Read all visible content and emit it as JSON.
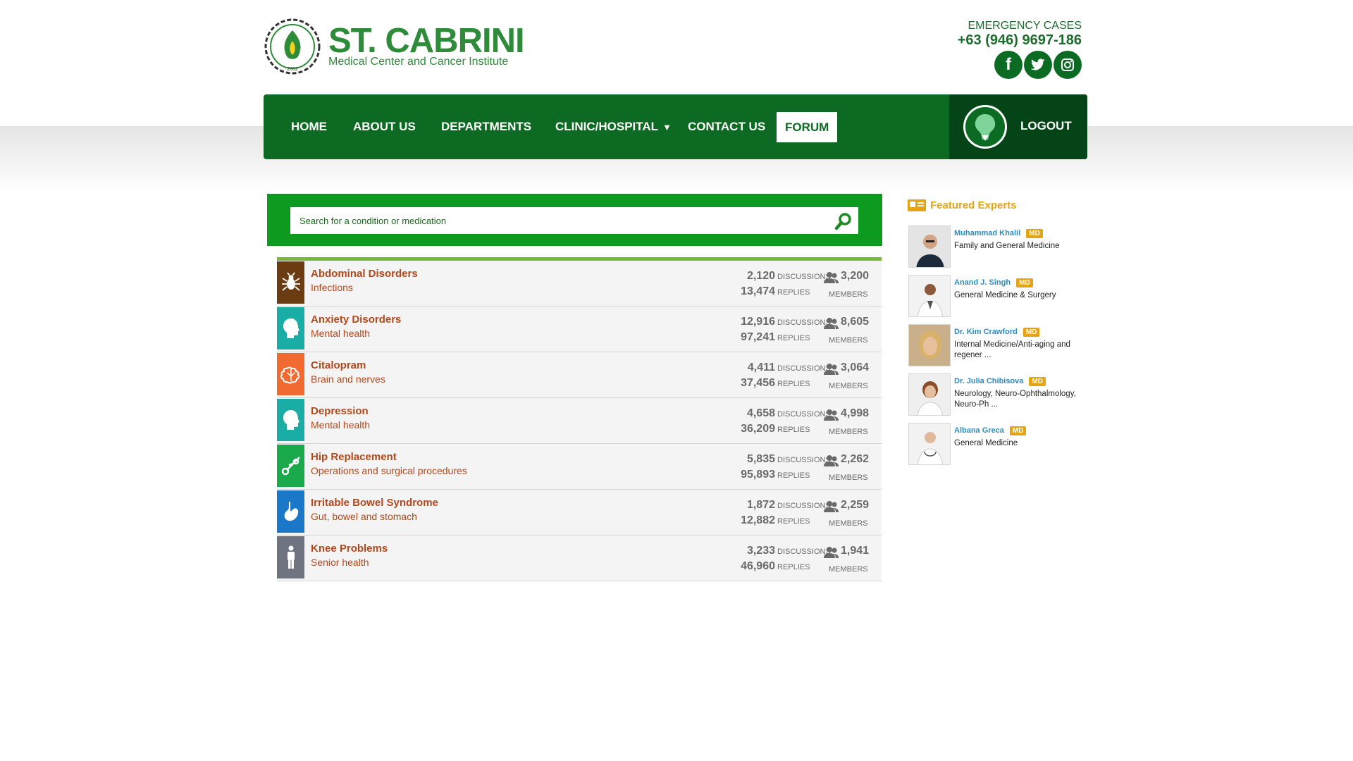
{
  "brand": {
    "name": "ST. CABRINI",
    "subtitle": "Medical Center and Cancer Institute",
    "logo_year": "2002"
  },
  "contact": {
    "emergency_label": "EMERGENCY CASES",
    "phone": "+63 (946) 9697-186",
    "social": [
      "facebook-icon",
      "twitter-icon",
      "instagram-icon"
    ]
  },
  "nav": {
    "home": "HOME",
    "about": "ABOUT US",
    "departments": "DEPARTMENTS",
    "clinic": "CLINIC/HOSPITAL",
    "contact": "CONTACT US",
    "forum": "FORUM",
    "logout": "LOGOUT"
  },
  "search": {
    "placeholder": "Search for a condition or medication"
  },
  "labels": {
    "discussions": "DISCUSSIONS",
    "replies": "REPLIES",
    "members": "MEMBERS"
  },
  "topics": [
    {
      "title": "Abdominal Disorders",
      "sub": "Infections",
      "discussions": "2,120",
      "replies": "13,474",
      "members": "3,200",
      "color": "#6b3b12",
      "icon": "bug-icon"
    },
    {
      "title": "Anxiety Disorders",
      "sub": "Mental health",
      "discussions": "12,916",
      "replies": "97,241",
      "members": "8,605",
      "color": "#1aada6",
      "icon": "head-icon"
    },
    {
      "title": "Citalopram",
      "sub": "Brain and nerves",
      "discussions": "4,411",
      "replies": "37,456",
      "members": "3,064",
      "color": "#f06a32",
      "icon": "brain-icon"
    },
    {
      "title": "Depression",
      "sub": "Mental health",
      "discussions": "4,658",
      "replies": "36,209",
      "members": "4,998",
      "color": "#1aada6",
      "icon": "head-icon"
    },
    {
      "title": "Hip Replacement",
      "sub": "Operations and surgical procedures",
      "discussions": "5,835",
      "replies": "95,893",
      "members": "2,262",
      "color": "#1aaa4c",
      "icon": "scissors-icon"
    },
    {
      "title": "Irritable Bowel Syndrome",
      "sub": "Gut, bowel and stomach",
      "discussions": "1,872",
      "replies": "12,882",
      "members": "2,259",
      "color": "#1b78c9",
      "icon": "stomach-icon"
    },
    {
      "title": "Knee Problems",
      "sub": "Senior health",
      "discussions": "3,233",
      "replies": "46,960",
      "members": "1,941",
      "color": "#6f7480",
      "icon": "person-icon"
    }
  ],
  "featured": {
    "title": "Featured Experts",
    "badge": "MD",
    "experts": [
      {
        "name": "Muhammad Khalil",
        "spec": "Family and General Medicine"
      },
      {
        "name": "Anand J. Singh",
        "spec": "General Medicine & Surgery"
      },
      {
        "name": "Dr. Kim Crawford",
        "spec": "Internal Medicine/Anti-aging and regener ..."
      },
      {
        "name": "Dr. Julia Chibisova",
        "spec": "Neurology, Neuro-Ophthalmology, Neuro-Ph ..."
      },
      {
        "name": "Albana Greca",
        "spec": "General Medicine"
      }
    ]
  }
}
